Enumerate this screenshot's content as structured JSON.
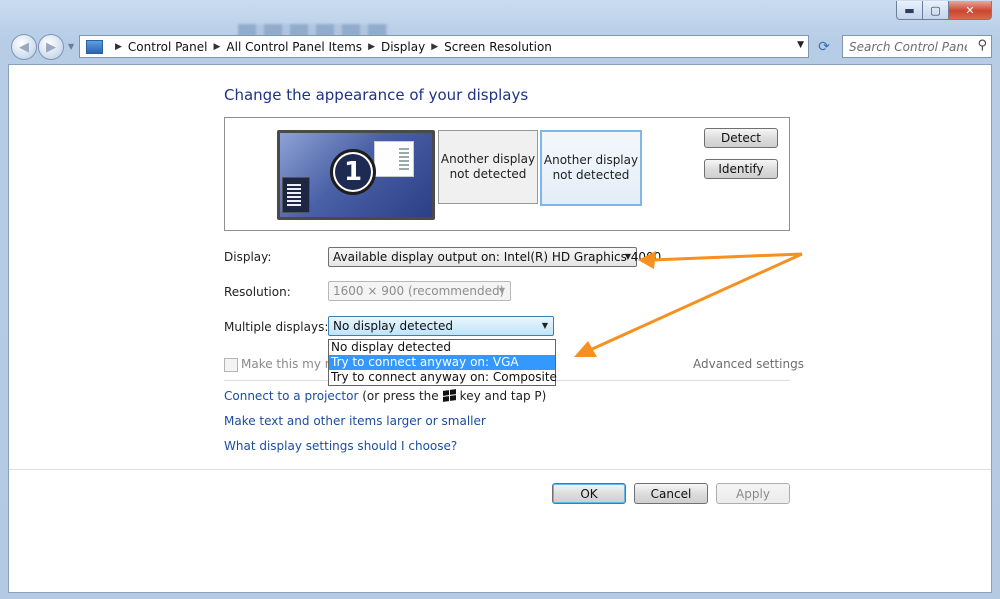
{
  "window": {
    "minimize_glyph": "▬",
    "maximize_glyph": "▢",
    "close_glyph": "✕"
  },
  "nav": {
    "back_glyph": "◀",
    "forward_glyph": "▶",
    "recent_glyph": "▼"
  },
  "address": {
    "icon": "control-panel-icon",
    "crumbs": [
      "Control Panel",
      "All Control Panel Items",
      "Display",
      "Screen Resolution"
    ],
    "separator": "▶",
    "dropdown_glyph": "▼",
    "refresh_glyph": "⟳"
  },
  "search": {
    "placeholder": "Search Control Panel",
    "icon_glyph": "⚲"
  },
  "main": {
    "heading": "Change the appearance of your displays",
    "monitors": [
      {
        "number": "1"
      },
      {
        "label_line1": "Another display",
        "label_line2": "not detected"
      },
      {
        "label_line1": "Another display",
        "label_line2": "not detected"
      }
    ],
    "detect_label": "Detect",
    "identify_label": "Identify",
    "display_label": "Display:",
    "display_value": "Available display output on: Intel(R) HD Graphics 4000",
    "resolution_label": "Resolution:",
    "resolution_value": "1600 × 900 (recommended)",
    "multiple_label": "Multiple displays:",
    "multiple_value": "No display detected",
    "multiple_options": [
      "No display detected",
      "Try to connect anyway on: VGA",
      "Try to connect anyway on: Composite"
    ],
    "multiple_highlighted_index": 1,
    "main_display_checkbox_label": "Make this my ma",
    "advanced_settings": "Advanced settings",
    "link_projector": "Connect to a projector",
    "link_projector_tail_1": "(or press the",
    "link_projector_tail_2": "key and tap P)",
    "link_text_size": "Make text and other items larger or smaller",
    "link_which_settings": "What display settings should I choose?",
    "ok_label": "OK",
    "cancel_label": "Cancel",
    "apply_label": "Apply",
    "dropdown_arrow": "▼"
  },
  "colors": {
    "heading": "#1e3287",
    "link": "#1b4da3",
    "highlight": "#3399ff",
    "annotation_arrow": "#f7901e"
  }
}
